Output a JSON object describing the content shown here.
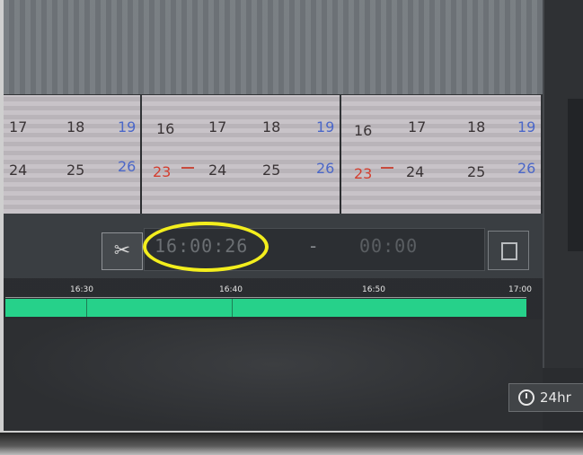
{
  "calendar": {
    "panel1": {
      "row1": [
        "17",
        "18",
        "19"
      ],
      "row2": [
        "24",
        "25",
        "26"
      ]
    },
    "panel2": {
      "row1": [
        "16",
        "17",
        "18",
        "19"
      ],
      "row2": [
        "23",
        "24",
        "25",
        "26"
      ]
    },
    "panel3": {
      "row1": [
        "16",
        "17",
        "18",
        "19"
      ],
      "row2": [
        "23",
        "24",
        "25",
        "26"
      ]
    }
  },
  "clip": {
    "start_time": "16:00:26",
    "separator": "-",
    "end_time": "00:00"
  },
  "timeline": {
    "labels": [
      "16:30",
      "16:40",
      "16:50",
      "17:00"
    ],
    "bar_color": "#26d18a"
  },
  "time_format_label": "24hr",
  "icons": {
    "clip": "scissors-icon",
    "save": "save-icon",
    "clock": "clock-icon"
  },
  "highlight_color": "#f3ee1d"
}
